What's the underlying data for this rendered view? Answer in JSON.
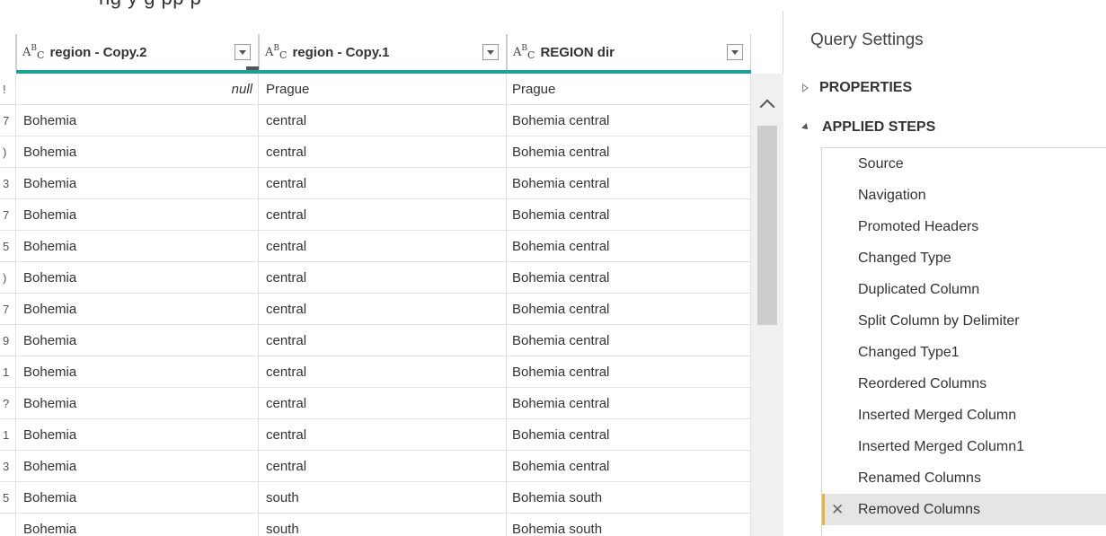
{
  "top_strip": {
    "text": "ng     y  g                                              pp    p"
  },
  "grid": {
    "columns": [
      {
        "title": "region - Copy.2",
        "type_icon": "text-type-icon"
      },
      {
        "title": "region - Copy.1",
        "type_icon": "text-type-icon"
      },
      {
        "title": "REGION dir",
        "type_icon": "text-type-icon"
      }
    ],
    "rows": [
      {
        "idx": "!",
        "c1": "null",
        "c2": "Prague",
        "c3": "Prague"
      },
      {
        "idx": "7",
        "c1": "Bohemia",
        "c2": "central",
        "c3": "Bohemia central"
      },
      {
        "idx": ")",
        "c1": "Bohemia",
        "c2": "central",
        "c3": "Bohemia central"
      },
      {
        "idx": "3",
        "c1": "Bohemia",
        "c2": "central",
        "c3": "Bohemia central"
      },
      {
        "idx": "7",
        "c1": "Bohemia",
        "c2": "central",
        "c3": "Bohemia central"
      },
      {
        "idx": "5",
        "c1": "Bohemia",
        "c2": "central",
        "c3": "Bohemia central"
      },
      {
        "idx": ")",
        "c1": "Bohemia",
        "c2": "central",
        "c3": "Bohemia central"
      },
      {
        "idx": "7",
        "c1": "Bohemia",
        "c2": "central",
        "c3": "Bohemia central"
      },
      {
        "idx": "9",
        "c1": "Bohemia",
        "c2": "central",
        "c3": "Bohemia central"
      },
      {
        "idx": "1",
        "c1": "Bohemia",
        "c2": "central",
        "c3": "Bohemia central"
      },
      {
        "idx": "?",
        "c1": "Bohemia",
        "c2": "central",
        "c3": "Bohemia central"
      },
      {
        "idx": "1",
        "c1": "Bohemia",
        "c2": "central",
        "c3": "Bohemia central"
      },
      {
        "idx": "3",
        "c1": "Bohemia",
        "c2": "central",
        "c3": "Bohemia central"
      },
      {
        "idx": "5",
        "c1": "Bohemia",
        "c2": "south",
        "c3": "Bohemia south"
      },
      {
        "idx": "",
        "c1": "Bohemia",
        "c2": "south",
        "c3": "Bohemia south"
      }
    ]
  },
  "settings": {
    "title": "Query Settings",
    "properties_label": "PROPERTIES",
    "applied_steps_label": "APPLIED STEPS",
    "steps": [
      "Source",
      "Navigation",
      "Promoted Headers",
      "Changed Type",
      "Duplicated Column",
      "Split Column by Delimiter",
      "Changed Type1",
      "Reordered Columns",
      "Inserted Merged Column",
      "Inserted Merged Column1",
      "Renamed Columns",
      "Removed Columns"
    ],
    "selected_step_index": 11,
    "delete_step_glyph": "✕"
  },
  "colors": {
    "accent_teal": "#21a196",
    "selected_step_marker": "#e8b43a"
  }
}
